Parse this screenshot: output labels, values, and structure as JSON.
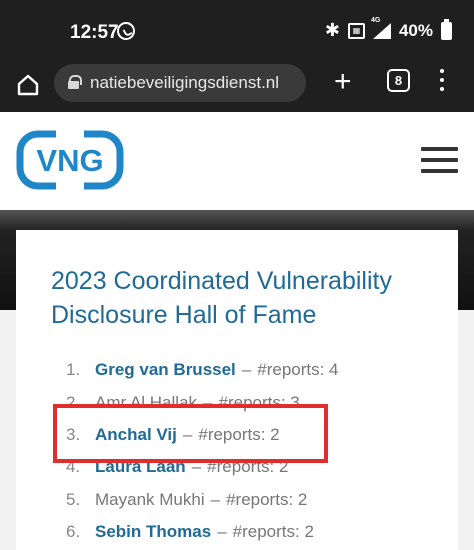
{
  "status_bar": {
    "time": "12:57",
    "network_label": "4G",
    "battery": "40%"
  },
  "browser": {
    "url": "natiebeveiligingsdienst.nl",
    "tab_count": "8"
  },
  "site": {
    "logo_text": "VNG",
    "logo_color": "#1f86c7"
  },
  "page": {
    "title": "2023 Coordinated Vulnerability Disclosure Hall of Fame",
    "hall_of_fame": [
      {
        "num": "1.",
        "name": "Greg van Brussel",
        "linked": true,
        "sep": "–",
        "reports": "#reports: 4"
      },
      {
        "num": "2.",
        "name": "Amr Al Hallak",
        "linked": false,
        "sep": "–",
        "reports": "#reports: 3"
      },
      {
        "num": "3.",
        "name": "Anchal Vij",
        "linked": true,
        "sep": "–",
        "reports": "#reports: 2"
      },
      {
        "num": "4.",
        "name": "Laura Laan",
        "linked": true,
        "sep": "–",
        "reports": "#reports: 2"
      },
      {
        "num": "5.",
        "name": "Mayank Mukhi",
        "linked": false,
        "sep": "–",
        "reports": "#reports: 2"
      },
      {
        "num": "6.",
        "name": "Sebin Thomas",
        "linked": true,
        "sep": "–",
        "reports": "#reports: 2"
      }
    ]
  },
  "colors": {
    "link": "#1f6a96",
    "highlight": "#e02d2d"
  }
}
